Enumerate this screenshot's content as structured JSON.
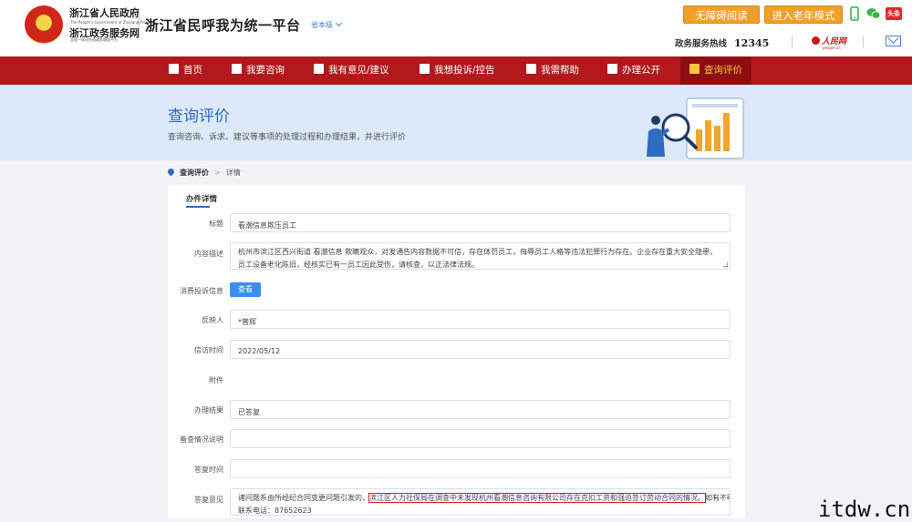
{
  "header": {
    "gov_name": "浙江省人民政府",
    "gov_name_en": "The People's Government of Zhejiang Province",
    "service_name": "浙江政务服务网",
    "service_sub": "全国一体化在线政务服务平台",
    "platform_title": "浙江省民呼我为统一平台",
    "level": "省本级",
    "accessible_btn": "无障碍阅读",
    "elder_btn": "进入老年模式",
    "hotline_label": "政务服务热线",
    "hotline_number": "12345",
    "people_logo": "人民网",
    "people_logo_sub": "people.cn",
    "toutiao": "头条"
  },
  "nav": {
    "items": [
      {
        "label": "首页"
      },
      {
        "label": "我要咨询"
      },
      {
        "label": "我有意见/建议"
      },
      {
        "label": "我想投诉/控告"
      },
      {
        "label": "我需帮助"
      },
      {
        "label": "办理公开"
      },
      {
        "label": "查询评价"
      }
    ]
  },
  "banner": {
    "title": "查询评价",
    "desc": "查询咨询、诉求、建议等事项的处理过程和办理结果，并进行评价"
  },
  "breadcrumb": {
    "current": "查询评价",
    "separator": ">",
    "next": "详情"
  },
  "detail": {
    "section_title": "办件详情",
    "fields": {
      "title_label": "标题",
      "title_value": "看潮信息欺压员工",
      "content_label": "内容描述",
      "content_value": "杭州市滨江区西兴街道  看潮信息  欺瞒观众，对发通告内容数据不可信，存在体罚员工，侮辱员工人格等违法犯罪行为存在。企业存在重大安全隐患，员工设备老化陈旧，经核实已有一员工因此受伤，请核查，以正法律法规。",
      "consumer_label": "消费投诉信息",
      "consumer_btn": "查看",
      "reporter_label": "反映人",
      "reporter_value": "*普辉",
      "time_label": "信访时间",
      "time_value": "2022/05/12",
      "attach_label": "附件",
      "result_label": "办理结果",
      "result_value": "已答复",
      "record_label": "备查情况说明",
      "record_value": "",
      "reply_time_label": "答复时间",
      "reply_time_value": "",
      "reply_label": "答复意见",
      "reply_pre": "诸问题系由所经纪合同变更问题引发的，",
      "reply_highlight": "滨江区人力社保局在调查中未发现杭州看潮信息咨询有限公司存在克扣工资和强迫签订劳动合同的情况。",
      "reply_post": "如有不明事项可",
      "reply_line2": "联系电话：87652623"
    }
  },
  "watermark": "itdw.cn",
  "colors": {
    "brand_red": "#b3191c",
    "accent_blue": "#2f6cc0",
    "orange": "#f0a02a"
  }
}
